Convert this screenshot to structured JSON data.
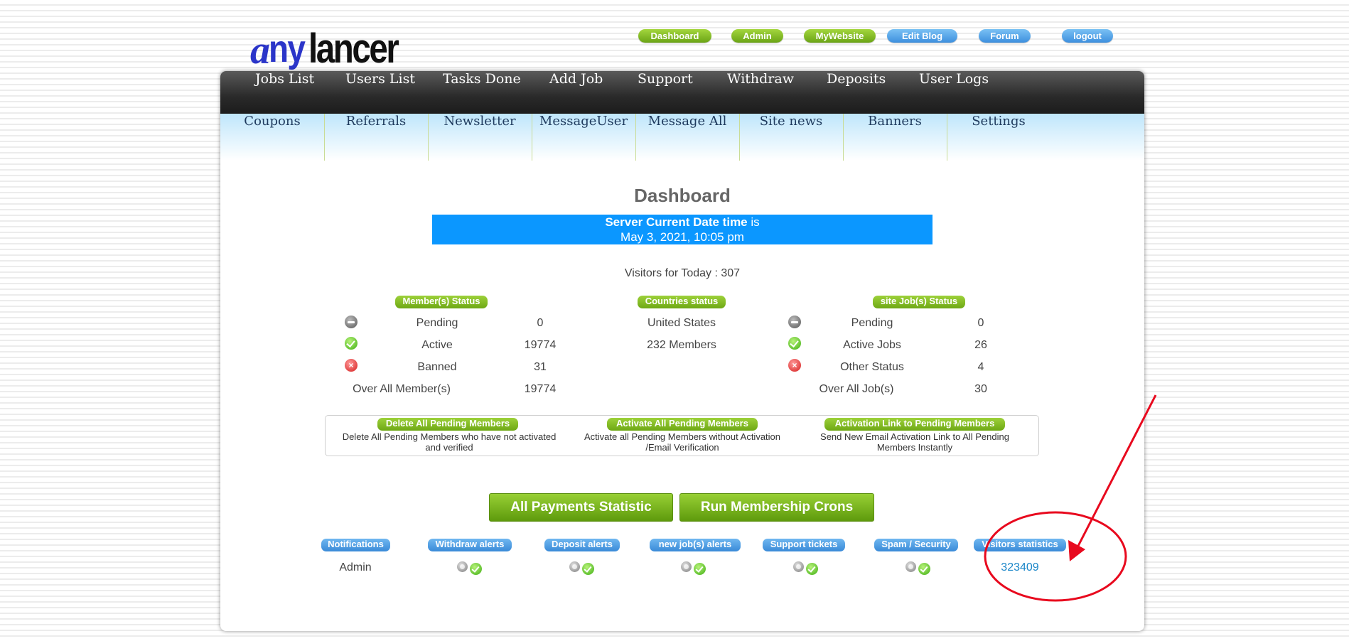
{
  "logo": {
    "a": "a",
    "ny": "ny",
    "rest": "lancer"
  },
  "top_links": [
    {
      "label": "Dashboard",
      "color": "green"
    },
    {
      "label": "Admin",
      "color": "green"
    },
    {
      "label": "MyWebsite",
      "color": "green"
    },
    {
      "label": "Edit Blog",
      "color": "blue"
    },
    {
      "label": "Forum",
      "color": "blue"
    },
    {
      "label": "logout",
      "color": "blue"
    }
  ],
  "nav_primary": [
    "Jobs List",
    "Users List",
    "Tasks Done",
    "Add Job",
    "Support",
    "Withdraw",
    "Deposits",
    "User Logs"
  ],
  "nav_secondary": [
    "Coupons",
    "Referrals",
    "Newsletter",
    "MessageUser",
    "Message All",
    "Site news",
    "Banners",
    "Settings"
  ],
  "page_title": "Dashboard",
  "server_time": {
    "label_bold": "Server Current Date time",
    "label_rest": " is",
    "value": "May 3, 2021, 10:05 pm"
  },
  "visitors_today": "Visitors for Today : 307",
  "member_status": {
    "title": "Member(s) Status",
    "rows": [
      {
        "icon": "pending-icon",
        "label": "Pending",
        "value": "0"
      },
      {
        "icon": "active-icon",
        "label": "Active",
        "value": "19774"
      },
      {
        "icon": "banned-icon",
        "label": "Banned",
        "value": "31"
      }
    ],
    "total_label": "Over All Member(s)",
    "total_value": "19774"
  },
  "countries_status": {
    "title": "Countries status",
    "country": "United States",
    "members": "232 Members"
  },
  "job_status": {
    "title": "site Job(s) Status",
    "rows": [
      {
        "icon": "pending-icon",
        "label": "Pending",
        "value": "0"
      },
      {
        "icon": "active-icon",
        "label": "Active Jobs",
        "value": "26"
      },
      {
        "icon": "banned-icon",
        "label": "Other Status",
        "value": "4"
      }
    ],
    "total_label": "Over All Job(s)",
    "total_value": "30"
  },
  "actions": [
    {
      "button": "Delete All Pending Members",
      "desc1": "Delete All Pending Members who have not activated",
      "desc2": "and verified"
    },
    {
      "button": "Activate All Pending Members",
      "desc1": "Activate all Pending Members without Activation",
      "desc2": "/Email Verification"
    },
    {
      "button": "Activation Link to Pending Members",
      "desc1": "Send New Email Activation Link to All Pending",
      "desc2": "Members Instantly"
    }
  ],
  "big_buttons": [
    "All Payments Statistic",
    "Run Membership Crons"
  ],
  "alerts": {
    "headers": [
      "Notifications",
      "Withdraw alerts",
      "Deposit alerts",
      "new job(s) alerts",
      "Support tickets",
      "Spam / Security",
      "Visitors statistics"
    ],
    "notifications_value": "Admin",
    "visitors_value": "323409"
  },
  "colors": {
    "accent_blue": "#0b97ff",
    "green": "#7cb518",
    "annotation_red": "#e8091e",
    "link_blue": "#1a86c8"
  }
}
